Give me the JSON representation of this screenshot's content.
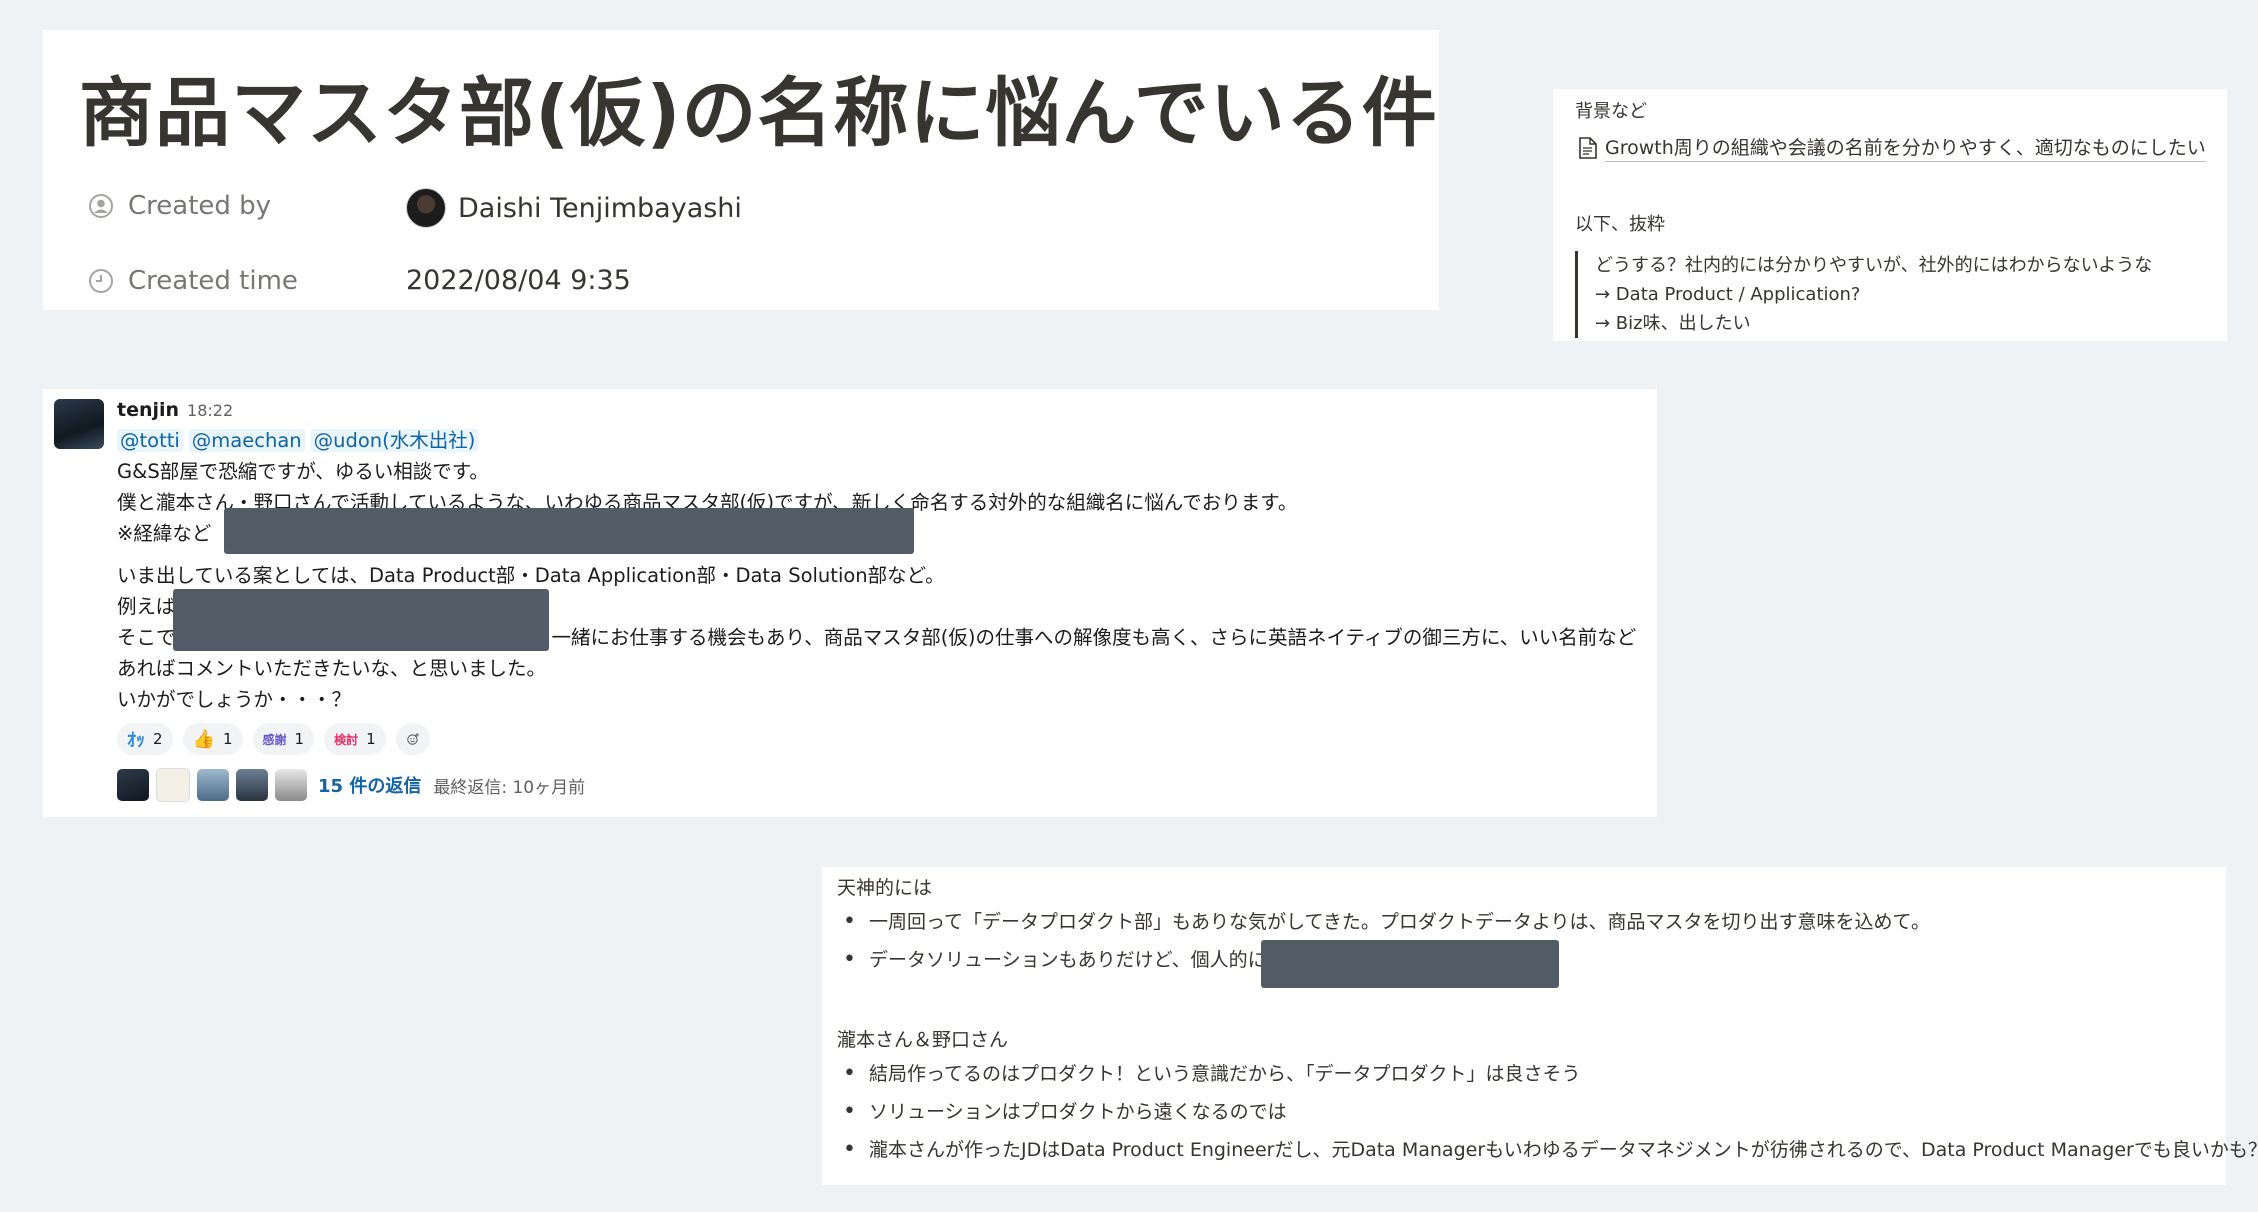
{
  "notion": {
    "title": "商品マスタ部(仮)の名称に悩んでいる件",
    "created_by_label": "Created by",
    "created_by_value": "Daishi Tenjimbayashi",
    "created_time_label": "Created time",
    "created_time_value": "2022/08/04 9:35"
  },
  "background": {
    "heading": "背景など",
    "link_text": "Growth周りの組織や会議の名前を分かりやすく、適切なものにしたい",
    "excerpt_heading": "以下、抜粋",
    "quote_lines": [
      "どうする？社内的には分かりやすいが、社外的にはわからないような",
      "→ Data Product / Application?",
      "→ Biz味、出したい"
    ]
  },
  "slack": {
    "user": "tenjin",
    "time": "18:22",
    "mentions": [
      "@totti",
      "@maechan",
      "@udon(水木出社)"
    ],
    "lines": [
      "G&S部屋で恐縮ですが、ゆるい相談です。",
      "僕と瀧本さん・野口さんで活動しているような、いわゆる商品マスタ部(仮)ですが、新しく命名する対外的な組織名に悩んでおります。",
      "※経緯など",
      "いま出している案としては、Data Product部・Data Application部・Data Solution部など。",
      "例えば",
      "そこで",
      "一緒にお仕事する機会もあり、商品マスタ部(仮)の仕事への解像度も高く、さらに英語ネイティブの御三方に、いい名前など",
      "あればコメントいただきたいな、と思いました。",
      "いかがでしょうか・・・？"
    ],
    "reactions": [
      {
        "emoji": "ｵｯ",
        "count": "2",
        "color": "#2b8be0"
      },
      {
        "emoji": "👍",
        "count": "1",
        "color": "#e0a82b"
      },
      {
        "emoji": "感謝",
        "count": "1",
        "color": "#6a5acd"
      },
      {
        "emoji": "検討",
        "count": "1",
        "color": "#e0316a"
      }
    ],
    "add_reaction_icon": "add-emoji-icon",
    "reply_count_text": "15 件の返信",
    "last_reply_text": "最終返信: 10ヶ月前"
  },
  "discussion": {
    "section1_heading": "天神的には",
    "section1_items": [
      "一周回って「データプロダクト部」もありな気がしてきた。プロダクトデータよりは、商品マスタを切り出す意味を込めて。",
      "データソリューションもありだけど、個人的に"
    ],
    "section2_heading": "瀧本さん＆野口さん",
    "section2_items": [
      "結局作ってるのはプロダクト！という意識だから、「データプロダクト」は良さそう",
      "ソリューションはプロダクトから遠くなるのでは",
      "瀧本さんが作ったJDはData Product Engineerだし、元Data Managerもいわゆるデータマネジメントが彷彿されるので、Data Product Managerでも良いかも？"
    ]
  }
}
